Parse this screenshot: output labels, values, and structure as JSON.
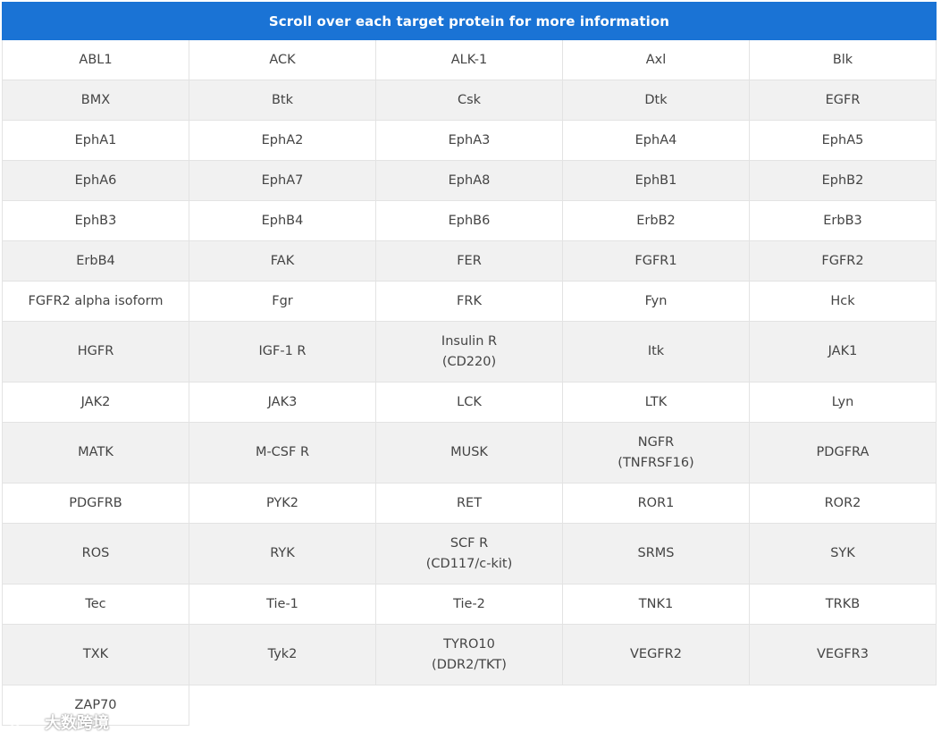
{
  "header": {
    "title": "Scroll over each target protein for more information"
  },
  "rows": [
    [
      "ABL1",
      "ACK",
      "ALK-1",
      "Axl",
      "Blk"
    ],
    [
      "BMX",
      "Btk",
      "Csk",
      "Dtk",
      "EGFR"
    ],
    [
      "EphA1",
      "EphA2",
      "EphA3",
      "EphA4",
      "EphA5"
    ],
    [
      "EphA6",
      "EphA7",
      "EphA8",
      "EphB1",
      "EphB2"
    ],
    [
      "EphB3",
      "EphB4",
      "EphB6",
      "ErbB2",
      "ErbB3"
    ],
    [
      "ErbB4",
      "FAK",
      "FER",
      "FGFR1",
      "FGFR2"
    ],
    [
      "FGFR2 alpha isoform",
      "Fgr",
      "FRK",
      "Fyn",
      "Hck"
    ],
    [
      "HGFR",
      "IGF-1 R",
      "Insulin R\n(CD220)",
      "Itk",
      "JAK1"
    ],
    [
      "JAK2",
      "JAK3",
      "LCK",
      "LTK",
      "Lyn"
    ],
    [
      "MATK",
      "M-CSF R",
      "MUSK",
      "NGFR\n(TNFRSF16)",
      "PDGFRA"
    ],
    [
      "PDGFRB",
      "PYK2",
      "RET",
      "ROR1",
      "ROR2"
    ],
    [
      "ROS",
      "RYK",
      "SCF R\n(CD117/c-kit)",
      "SRMS",
      "SYK"
    ],
    [
      "Tec",
      "Tie-1",
      "Tie-2",
      "TNK1",
      "TRKB"
    ],
    [
      "TXK",
      "Tyk2",
      "TYRO10\n(DDR2/TKT)",
      "VEGFR2",
      "VEGFR3"
    ],
    [
      "ZAP70"
    ]
  ],
  "watermark": {
    "text": "大数跨境"
  }
}
